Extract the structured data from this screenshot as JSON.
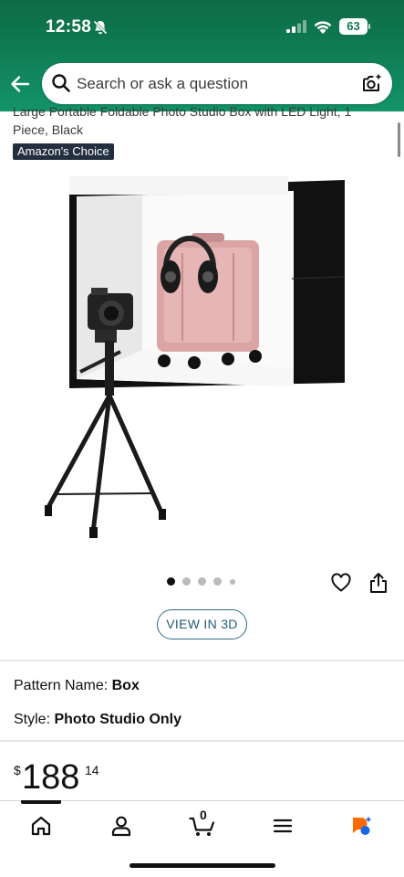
{
  "status_bar": {
    "time": "12:58",
    "battery": "63",
    "icons": [
      "mute-bell-icon",
      "signal-icon",
      "wifi-icon",
      "battery-icon"
    ]
  },
  "header": {
    "search_placeholder": "Search or ask a question",
    "icons": [
      "back-arrow-icon",
      "search-icon",
      "camera-search-icon"
    ]
  },
  "product": {
    "title": "Large Portable Foldable Photo Studio Box with LED Light, 1 Piece, Black",
    "badge_prefix": "Amazon's",
    "badge_suffix": "Choice",
    "image_alt_content": "photo-studio-box-with-camera-tripod-icon",
    "carousel": {
      "count": 5,
      "active_index": 0
    },
    "view_3d_label": "VIEW IN 3D",
    "variations": [
      {
        "label": "Pattern Name:",
        "value": "Box"
      },
      {
        "label": "Style:",
        "value": "Photo Studio Only"
      }
    ],
    "price": {
      "currency": "$",
      "whole": "188",
      "fraction": "14"
    }
  },
  "bottom_nav": {
    "items": [
      "home-icon",
      "account-icon",
      "cart-icon",
      "menu-icon",
      "rufus-icon"
    ],
    "cart_count": "0",
    "active_index": 0
  },
  "colors": {
    "header_green": "#0f7a52",
    "badge_navy": "#232f3e",
    "view3d_border": "#2e6c8a"
  }
}
